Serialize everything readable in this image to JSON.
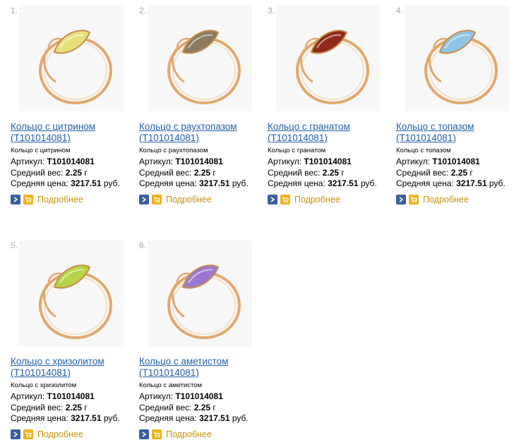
{
  "colors": {
    "link": "#1f5fa8",
    "number": "#a8a8a8",
    "more_link": "#c6920d",
    "go_icon": "#3a5f9e",
    "cart_icon": "#f0b21a",
    "gold": "#e2a86c"
  },
  "labels": {
    "article": "Артикул:",
    "weight": "Средний вес:",
    "price": "Средняя цена:",
    "more": "Подробнее"
  },
  "products": [
    {
      "num": "1.",
      "title": "Кольцо с цитрином (T101014081)",
      "subtitle": "Кольцо с цитрином",
      "article": "T101014081",
      "weight": "2.25",
      "weight_unit": "г",
      "price": "3217.51",
      "currency": "руб.",
      "stone_color": "#e6e07a",
      "icons": [
        "arrow-right-icon",
        "cart-icon"
      ]
    },
    {
      "num": "2.",
      "title": "Кольцо с раухтопазом (T101014081)",
      "subtitle": "Кольцо с раухтопазом",
      "article": "T101014081",
      "weight": "2.25",
      "weight_unit": "г",
      "price": "3217.51",
      "currency": "руб.",
      "stone_color": "#8a7c62",
      "icons": [
        "arrow-right-icon",
        "cart-icon"
      ]
    },
    {
      "num": "3.",
      "title": "Кольцо с гранатом (T101014081)",
      "subtitle": "Кольцо с гранатом",
      "article": "T101014081",
      "weight": "2.25",
      "weight_unit": "г",
      "price": "3217.51",
      "currency": "руб.",
      "stone_color": "#8e2a1a",
      "icons": [
        "arrow-right-icon",
        "cart-icon"
      ]
    },
    {
      "num": "4.",
      "title": "Кольцо с топазом (T101014081)",
      "subtitle": "Кольцо с топазом",
      "article": "T101014081",
      "weight": "2.25",
      "weight_unit": "г",
      "price": "3217.51",
      "currency": "руб.",
      "stone_color": "#8fc6e6",
      "icons": [
        "arrow-right-icon",
        "cart-icon"
      ]
    },
    {
      "num": "5.",
      "title": "Кольцо с хризолитом (T101014081)",
      "subtitle": "Кольцо с хризолитом",
      "article": "T101014081",
      "weight": "2.25",
      "weight_unit": "г",
      "price": "3217.51",
      "currency": "руб.",
      "stone_color": "#b6d548",
      "icons": [
        "arrow-right-icon",
        "cart-icon"
      ]
    },
    {
      "num": "6.",
      "title": "Кольцо с аметистом (T101014081)",
      "subtitle": "Кольцо с аметистом",
      "article": "T101014081",
      "weight": "2.25",
      "weight_unit": "г",
      "price": "3217.51",
      "currency": "руб.",
      "stone_color": "#9a78cf",
      "icons": [
        "arrow-right-icon",
        "cart-icon"
      ]
    }
  ]
}
